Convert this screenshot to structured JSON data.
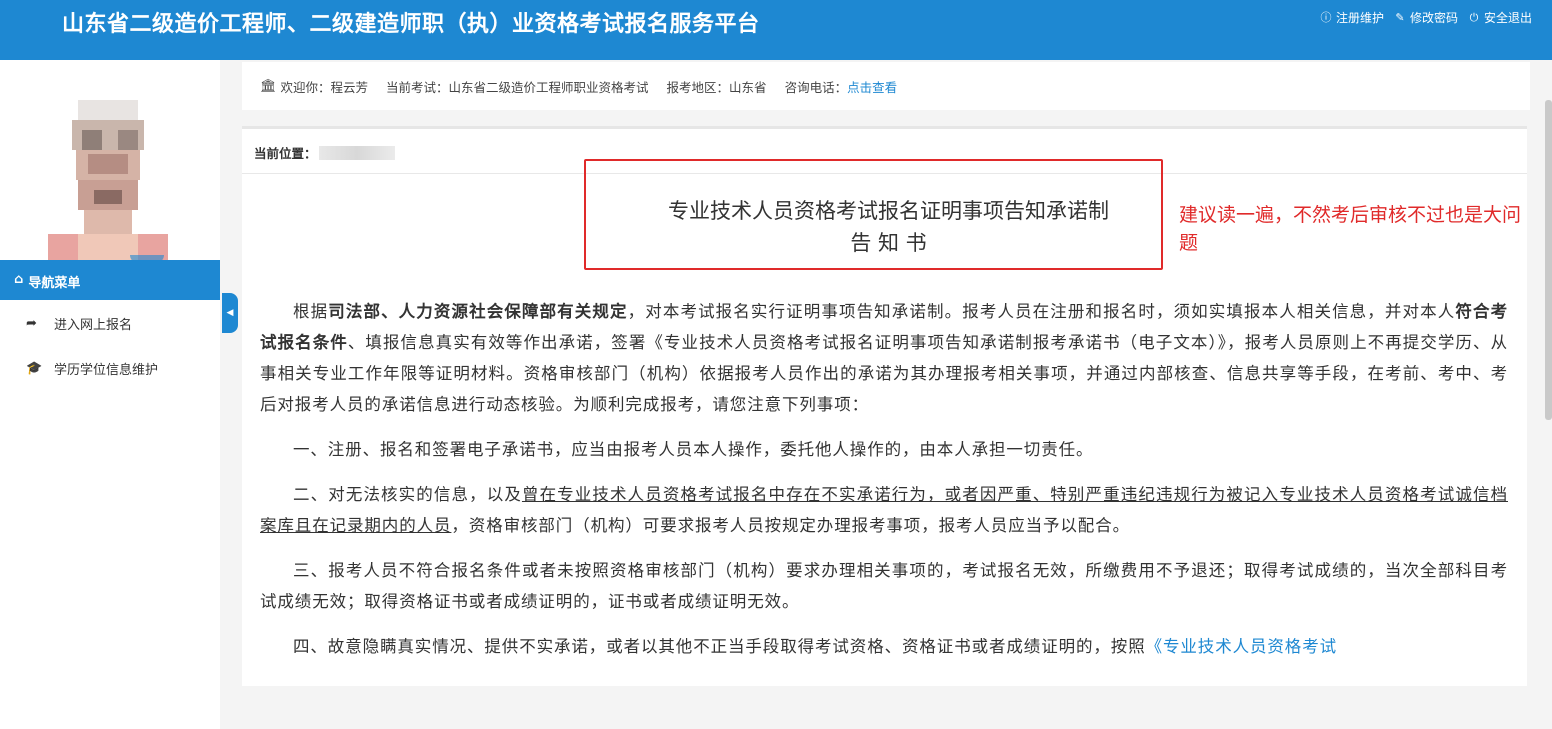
{
  "header": {
    "title": "山东省二级造价工程师、二级建造师职（执）业资格考试报名服务平台",
    "links": [
      "注册维护",
      "修改密码",
      "安全退出"
    ]
  },
  "sidebar": {
    "nav_title": "导航菜单",
    "items": [
      "进入网上报名",
      "学历学位信息维护"
    ]
  },
  "infobar": {
    "welcome": "欢迎你：程云芳",
    "exam": "当前考试：山东省二级造价工程师职业资格考试",
    "region": "报考地区：山东省",
    "phone_label": "咨询电话：",
    "phone_link": "点击查看"
  },
  "breadcrumb": {
    "label": "当前位置："
  },
  "notice": {
    "title_line1": "专业技术人员资格考试报名证明事项告知承诺制",
    "title_line2": "告 知 书"
  },
  "annotation": "建议读一遍，不然考后审核不过也是大问题",
  "paragraphs": {
    "p1_a": "根据",
    "p1_b": "司法部、人力资源社会保障部有关规定",
    "p1_c": "，对本考试报名实行证明事项告知承诺制。报考人员在注册和报名时，须如实填报本人相关信息，并对本人",
    "p1_d": "符合考试报名条件",
    "p1_e": "、填报信息真实有效等作出承诺，签署《专业技术人员资格考试报名证明事项告知承诺制报考承诺书（电子文本）》，报考人员原则上不再提交学历、从事相关专业工作年限等证明材料。资格审核部门（机构）依据报考人员作出的承诺为其办理报考相关事项，并通过内部核查、信息共享等手段，在考前、考中、考后对报考人员的承诺信息进行动态核验。为顺利完成报考，请您注意下列事项：",
    "p2": "一、注册、报名和签署电子承诺书，应当由报考人员本人操作，委托他人操作的，由本人承担一切责任。",
    "p3_a": "二、对无法核实的信息，以及",
    "p3_b": "曾在专业技术人员资格考试报名中存在不实承诺行为，或者因严重、特别严重违纪违规行为被记入专业技术人员资格考试诚信档案库且在记录期内的人员",
    "p3_c": "，资格审核部门（机构）可要求报考人员按规定办理报考事项，报考人员应当予以配合。",
    "p4": "三、报考人员不符合报名条件或者未按照资格审核部门（机构）要求办理相关事项的，考试报名无效，所缴费用不予退还；取得考试成绩的，当次全部科目考试成绩无效；取得资格证书或者成绩证明的，证书或者成绩证明无效。",
    "p5_a": "四、故意隐瞒真实情况、提供不实承诺，或者以其他不正当手段取得考试资格、资格证书或者成绩证明的，按照",
    "p5_b": "《专业技术人员资格考试"
  },
  "colors": {
    "primary": "#1e88d2",
    "annotation": "#e02a2a"
  }
}
